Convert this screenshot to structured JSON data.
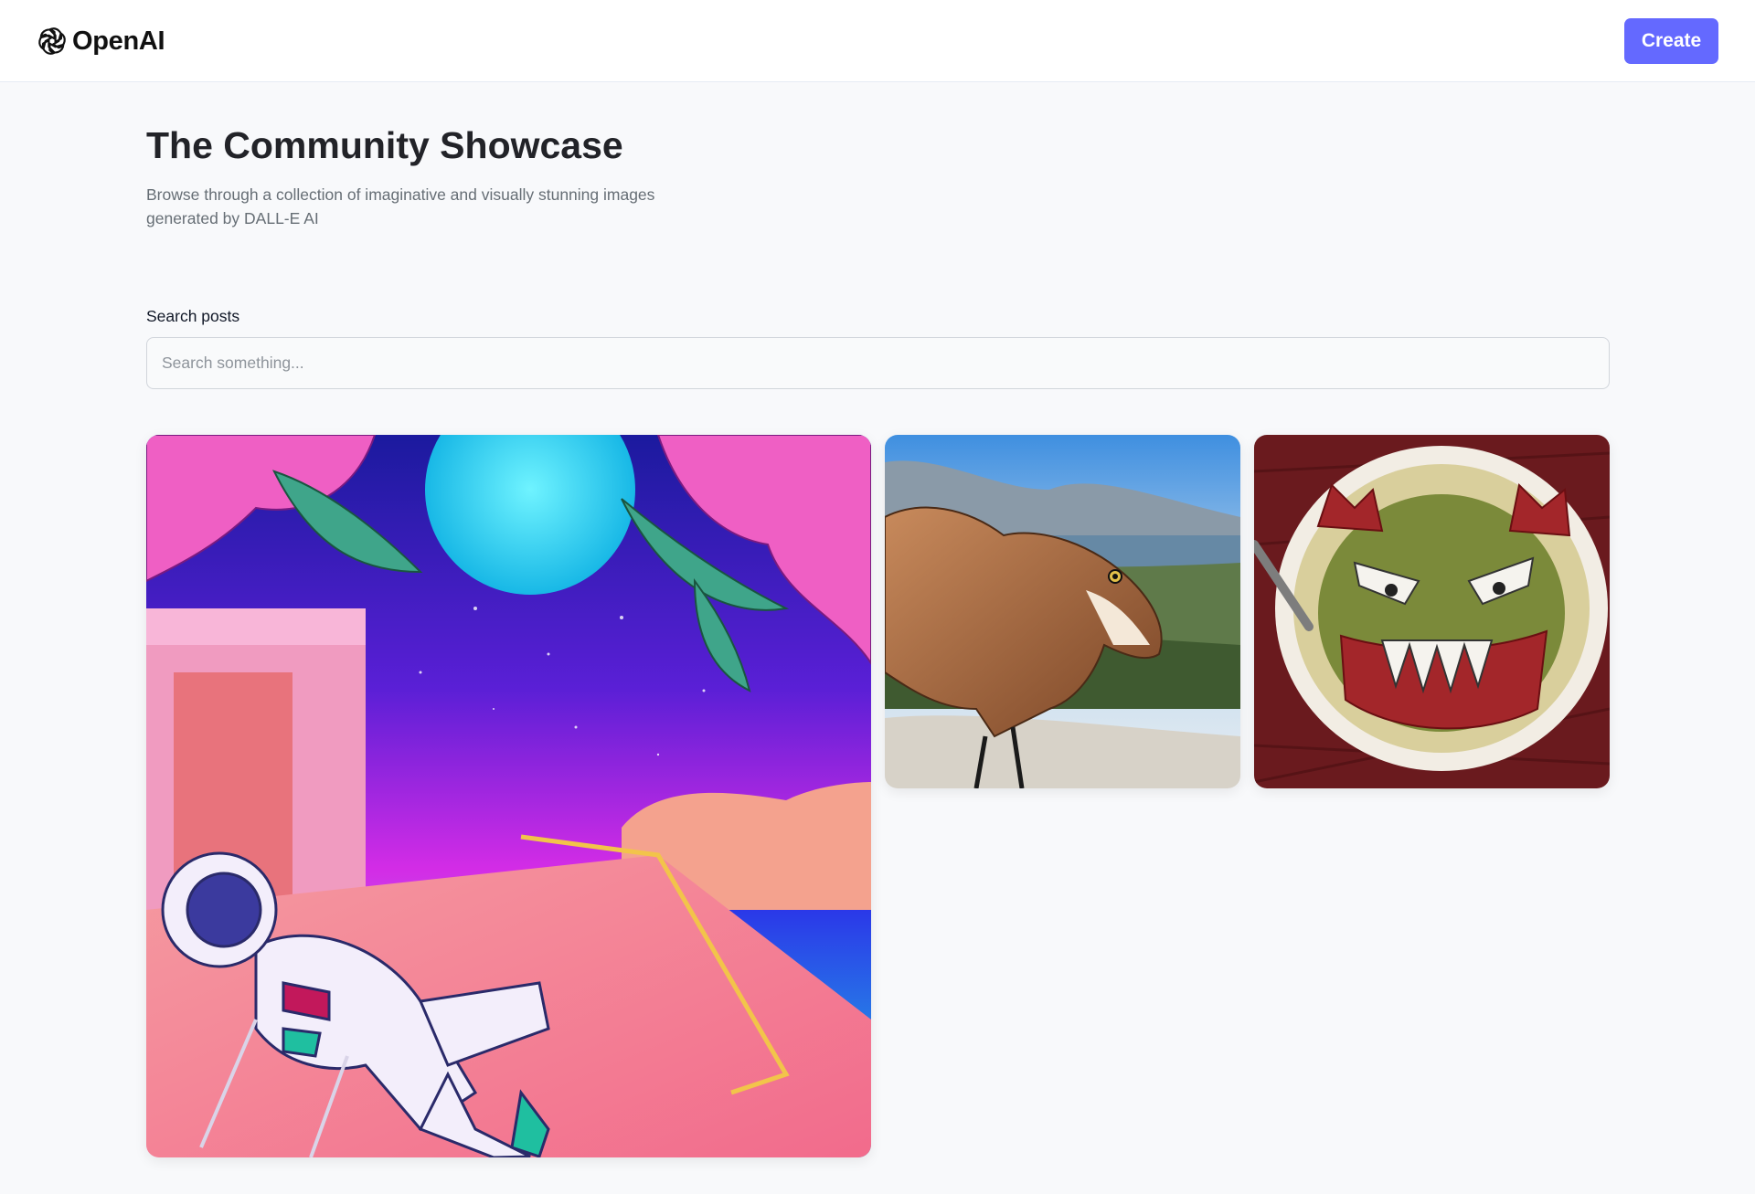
{
  "header": {
    "logo_text": "OpenAI",
    "logo_icon": "openai-logo-icon",
    "create_label": "Create",
    "accent_color": "#6469ff"
  },
  "main": {
    "title": "The Community Showcase",
    "subtitle": "Browse through a collection of imaginative and visually stunning images generated by DALL-E AI",
    "search": {
      "label": "Search posts",
      "placeholder": "Search something...",
      "value": ""
    }
  },
  "gallery": {
    "items": [
      {
        "subject": "astronaut-lounging-tropical-synthwave"
      },
      {
        "subject": "toy-dinosaur-coastal-view"
      },
      {
        "subject": "crochet-monster-soup-bowl"
      }
    ]
  }
}
